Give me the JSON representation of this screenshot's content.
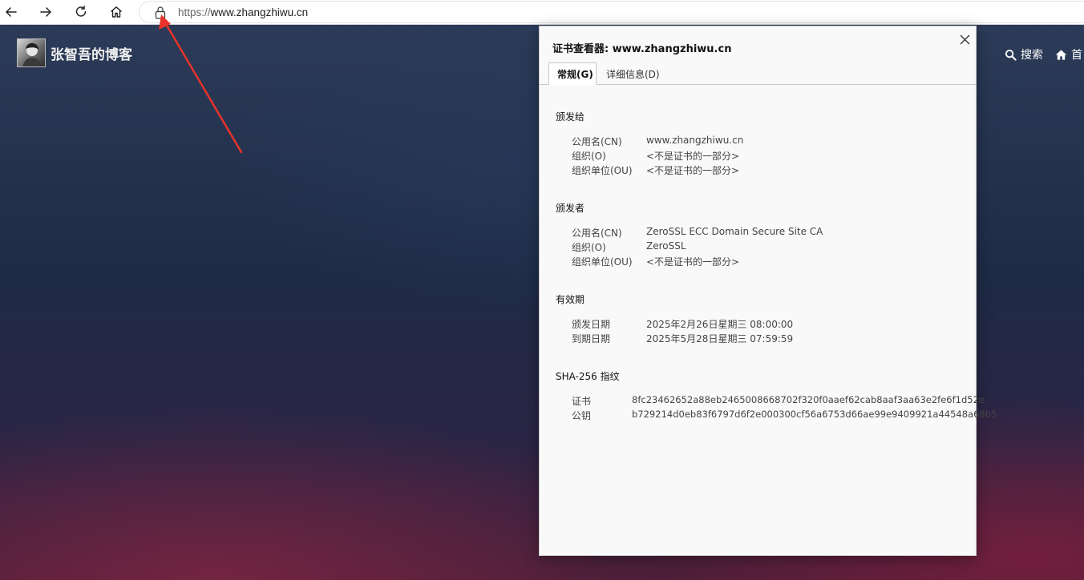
{
  "browser": {
    "back_icon": "arrow-left-icon",
    "forward_icon": "arrow-right-icon",
    "refresh_icon": "refresh-icon",
    "home_icon": "home-icon",
    "lock_icon": "lock-icon",
    "url_protocol": "https://",
    "url_host": "www.zhangzhiwu.cn"
  },
  "site": {
    "title": "张智吾的博客",
    "nav": {
      "search_label": "搜索",
      "home_label": "首"
    }
  },
  "dialog": {
    "title": "证书查看器: www.zhangzhiwu.cn",
    "tabs": [
      {
        "label": "常规(G)",
        "active": true
      },
      {
        "label": "详细信息(D)",
        "active": false
      }
    ],
    "issued_to": {
      "heading": "颁发给",
      "rows": [
        {
          "key": "公用名(CN)",
          "value": "www.zhangzhiwu.cn"
        },
        {
          "key": "组织(O)",
          "value": "<不是证书的一部分>"
        },
        {
          "key": "组织单位(OU)",
          "value": "<不是证书的一部分>"
        }
      ]
    },
    "issued_by": {
      "heading": "颁发者",
      "rows": [
        {
          "key": "公用名(CN)",
          "value": "ZeroSSL ECC Domain Secure Site CA"
        },
        {
          "key": "组织(O)",
          "value": "ZeroSSL"
        },
        {
          "key": "组织单位(OU)",
          "value": "<不是证书的一部分>"
        }
      ]
    },
    "validity": {
      "heading": "有效期",
      "rows": [
        {
          "key": "颁发日期",
          "value": "2025年2月26日星期三 08:00:00"
        },
        {
          "key": "到期日期",
          "value": "2025年5月28日星期三 07:59:59"
        }
      ]
    },
    "fingerprints": {
      "heading": "SHA-256 指纹",
      "rows": [
        {
          "key": "证书",
          "value": "8fc23462652a88eb2465008668702f320f0aaef62cab8aaf3aa63e2fe6f1d52e"
        },
        {
          "key": "公钥",
          "value": "b729214d0eb83f6797d6f2e000300cf56a6753d66ae99e9409921a44548a68b5"
        }
      ]
    }
  },
  "colors": {
    "annotation_arrow": "#e8332a",
    "dialog_bg": "#f9f9f9"
  }
}
